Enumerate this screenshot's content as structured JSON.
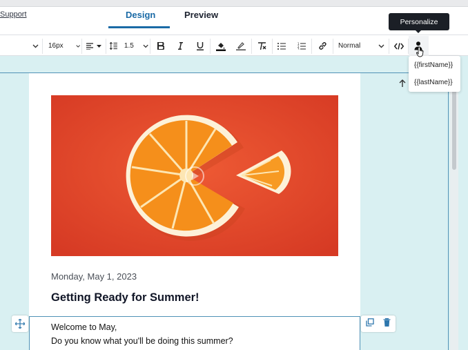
{
  "header": {
    "support_link": "Support",
    "tabs": [
      {
        "label": "Design",
        "active": true
      },
      {
        "label": "Preview",
        "active": false
      }
    ]
  },
  "toolbar": {
    "font_size": "16px",
    "line_height": "1.5",
    "block_style": "Normal",
    "icons": [
      "chevron-down-icon",
      "align-left-icon",
      "line-height-icon",
      "bold-icon",
      "italic-icon",
      "underline-icon",
      "text-color-icon",
      "highlight-icon",
      "clear-format-icon",
      "bullet-list-icon",
      "numbered-list-icon",
      "link-icon",
      "code-icon",
      "personalize-icon"
    ]
  },
  "tooltip": {
    "label": "Personalize"
  },
  "personalize_menu": {
    "items": [
      "{{firstName}}",
      "{{lastName}}"
    ]
  },
  "email": {
    "date": "Monday, May 1, 2023",
    "headline": "Getting Ready for Summer!",
    "body_line1": "Welcome to May,",
    "body_line2": "Do you know what you'll be doing this summer?"
  },
  "colors": {
    "accent": "#1a6aa6",
    "canvas": "#d9f0f2",
    "selection": "#4f91b6",
    "hero_background": "#e0462c"
  }
}
